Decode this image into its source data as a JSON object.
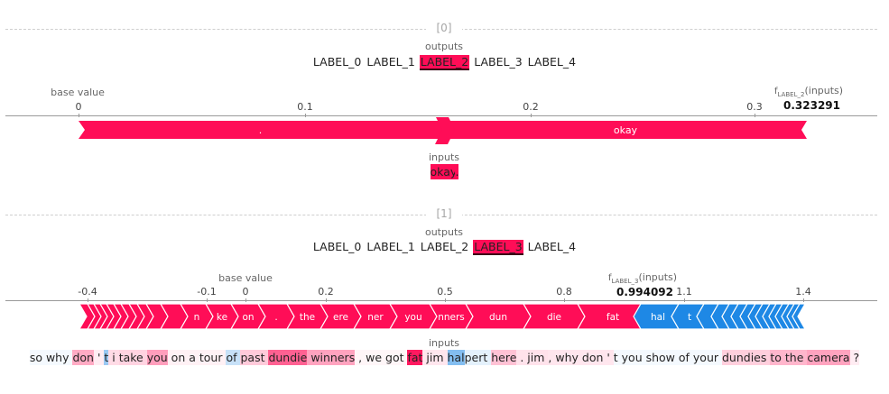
{
  "plot0": {
    "index": "[0]",
    "outputs_caption": "outputs",
    "labels": [
      "LABEL_0",
      "LABEL_1",
      "LABEL_2",
      "LABEL_3",
      "LABEL_4"
    ],
    "selected_label": 2,
    "base_value_caption": "base value",
    "fx_caption": "f",
    "fx_sub": "LABEL_2",
    "fx_suffix": "(inputs)",
    "fx_value": "0.323291",
    "axis_ticks": [
      "0",
      "0.1",
      "0.2",
      "0.3"
    ],
    "base_value": 0.0,
    "output_value": 0.323291,
    "segments": [
      {
        "label": ".",
        "value": 0.161,
        "color": "#ff0d57"
      },
      {
        "label": "okay",
        "value": 0.162,
        "color": "#ff0d57"
      }
    ],
    "inputs_caption": "inputs",
    "tokens": [
      {
        "text": "okay",
        "shade": 1.0,
        "color": "#ff0d57"
      },
      {
        "text": ".",
        "shade": 1.0,
        "color": "#ff0d57"
      }
    ]
  },
  "plot1": {
    "index": "[1]",
    "outputs_caption": "outputs",
    "labels": [
      "LABEL_0",
      "LABEL_1",
      "LABEL_2",
      "LABEL_3",
      "LABEL_4"
    ],
    "selected_label": 3,
    "base_value_caption": "base value",
    "fx_caption": "f",
    "fx_sub": "LABEL_3",
    "fx_suffix": "(inputs)",
    "fx_value": "0.994092",
    "axis_ticks": [
      "-0.4",
      "-0.1",
      "0",
      "0.2",
      "0.5",
      "0.8",
      "1.1",
      "1.4"
    ],
    "base_value": 0.0,
    "output_value": 0.994092,
    "pos_segment_labels": [
      "",
      "",
      "",
      "",
      "",
      "",
      "",
      "",
      "",
      "n",
      "ke",
      "on",
      ".",
      "the",
      "ere",
      "ner",
      "you",
      "nners",
      "dun",
      "die",
      "fat"
    ],
    "neg_segment_labels": [
      "hal",
      "t",
      "",
      "",
      "",
      "",
      "",
      "",
      "",
      "",
      "",
      "",
      "",
      "",
      ""
    ],
    "inputs_caption": "inputs",
    "tokens": [
      {
        "text": "so why ",
        "shade": 0.05,
        "color": "#1e88e5"
      },
      {
        "text": "don",
        "shade": 0.35,
        "color": "#ff0d57"
      },
      {
        "text": " ' ",
        "shade": 0.08,
        "color": "#ff0d57"
      },
      {
        "text": "t",
        "shade": 0.45,
        "color": "#1e88e5"
      },
      {
        "text": " i ",
        "shade": 0.15,
        "color": "#ff0d57"
      },
      {
        "text": "take ",
        "shade": 0.18,
        "color": "#ff0d57"
      },
      {
        "text": "you",
        "shade": 0.4,
        "color": "#ff0d57"
      },
      {
        "text": " on a tour ",
        "shade": 0.06,
        "color": "#ff0d57"
      },
      {
        "text": "of ",
        "shade": 0.25,
        "color": "#1e88e5"
      },
      {
        "text": "past ",
        "shade": 0.22,
        "color": "#ff0d57"
      },
      {
        "text": "dundie",
        "shade": 0.65,
        "color": "#ff0d57"
      },
      {
        "text": " winners",
        "shade": 0.38,
        "color": "#ff0d57"
      },
      {
        "text": " , we got ",
        "shade": 0.04,
        "color": "#ff0d57"
      },
      {
        "text": "fat",
        "shade": 0.95,
        "color": "#ff0d57"
      },
      {
        "text": " jim ",
        "shade": 0.1,
        "color": "#ff0d57"
      },
      {
        "text": "hal",
        "shade": 0.55,
        "color": "#1e88e5"
      },
      {
        "text": "pert ",
        "shade": 0.12,
        "color": "#1e88e5"
      },
      {
        "text": "here",
        "shade": 0.25,
        "color": "#ff0d57"
      },
      {
        "text": " . jim ",
        "shade": 0.12,
        "color": "#ff0d57"
      },
      {
        "text": ", why don ' ",
        "shade": 0.1,
        "color": "#ff0d57"
      },
      {
        "text": "t you show of your ",
        "shade": 0.05,
        "color": "#1e88e5"
      },
      {
        "text": "dundies ",
        "shade": 0.2,
        "color": "#ff0d57"
      },
      {
        "text": "to the ",
        "shade": 0.3,
        "color": "#ff0d57"
      },
      {
        "text": "camera",
        "shade": 0.38,
        "color": "#ff0d57"
      },
      {
        "text": " ?",
        "shade": 0.08,
        "color": "#ff0d57"
      }
    ]
  }
}
